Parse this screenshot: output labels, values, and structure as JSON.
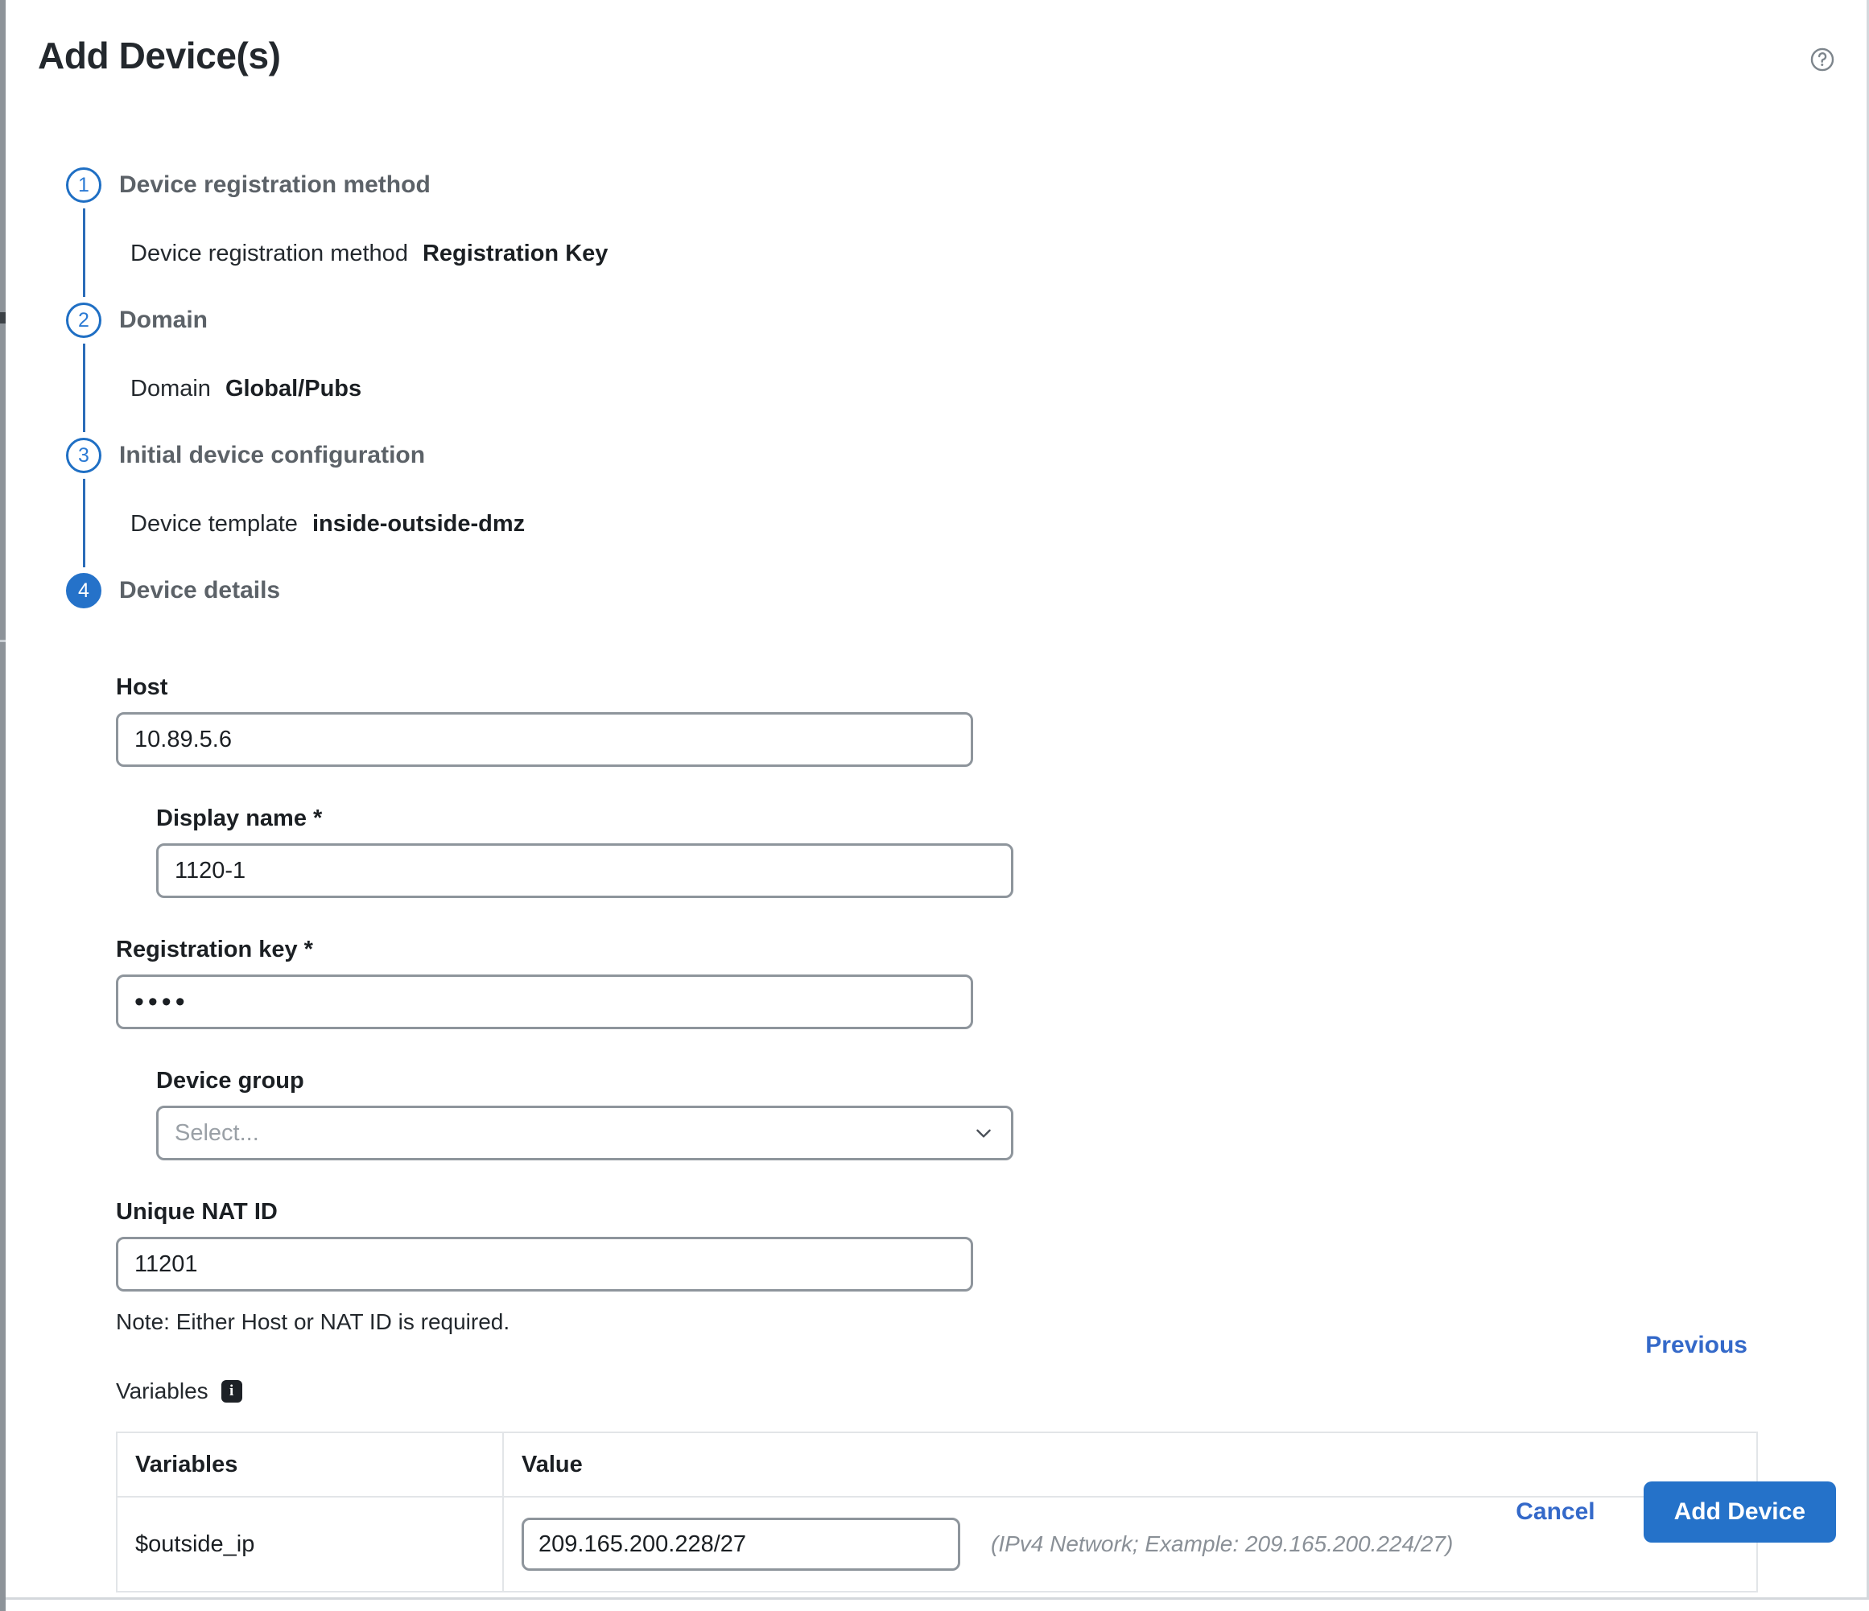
{
  "header": {
    "title": "Add Device(s)",
    "help_icon": "help-circle-icon"
  },
  "stepper": {
    "steps": [
      {
        "number": "1",
        "title": "Device registration method",
        "state": "completed",
        "summary_label": "Device registration method",
        "summary_value": "Registration Key"
      },
      {
        "number": "2",
        "title": "Domain",
        "state": "completed",
        "summary_label": "Domain",
        "summary_value": "Global/Pubs"
      },
      {
        "number": "3",
        "title": "Initial device configuration",
        "state": "completed",
        "summary_label": "Device template",
        "summary_value": "inside-outside-dmz"
      },
      {
        "number": "4",
        "title": "Device details",
        "state": "active"
      }
    ]
  },
  "form": {
    "host": {
      "label": "Host",
      "value": "10.89.5.6",
      "placeholder": ""
    },
    "display_name": {
      "label": "Display name *",
      "value": "1120-1",
      "placeholder": ""
    },
    "registration_key": {
      "label": "Registration key *",
      "value": "••••",
      "placeholder": ""
    },
    "device_group": {
      "label": "Device group",
      "value": "Select...",
      "chevron": "chevron-down-icon"
    },
    "nat_id": {
      "label": "Unique NAT ID",
      "value": "11201",
      "placeholder": ""
    },
    "note": "Note: Either Host or NAT ID is required.",
    "variables_section_label": "Variables",
    "variables_info_icon": "info-icon"
  },
  "variables_table": {
    "columns": [
      "Variables",
      "Value"
    ],
    "rows": [
      {
        "name": "$outside_ip",
        "value": "209.165.200.228/27",
        "hint": "(IPv4 Network; Example: 209.165.200.224/27)"
      }
    ]
  },
  "actions": {
    "previous": "Previous",
    "cancel": "Cancel",
    "submit": "Add Device"
  },
  "colors": {
    "accent": "#2572c9",
    "link": "#3469c9",
    "step_outline": "#1f6fc4",
    "label_text": "#1b1f23",
    "muted_text": "#8a9097"
  }
}
